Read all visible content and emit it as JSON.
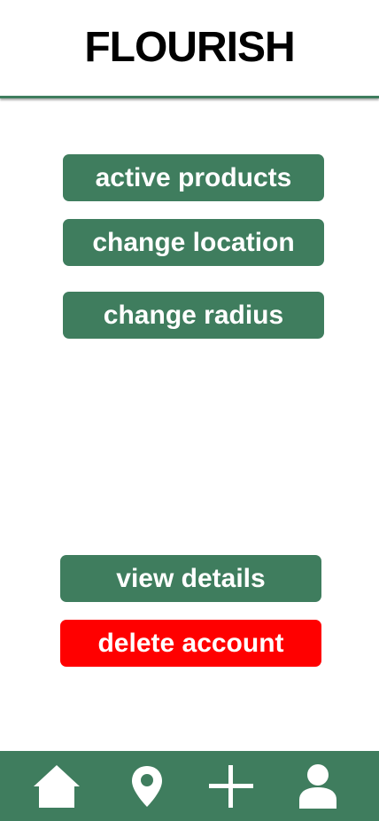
{
  "app": {
    "title": "FLOURISH"
  },
  "menu": {
    "active_products": "active products",
    "change_location": "change location",
    "change_radius": "change radius"
  },
  "account": {
    "view_details": "view details",
    "delete_account": "delete account"
  },
  "nav": {
    "items": [
      {
        "icon": "home-icon"
      },
      {
        "icon": "location-pin-icon"
      },
      {
        "icon": "plus-icon"
      },
      {
        "icon": "user-icon"
      }
    ]
  },
  "colors": {
    "accent": "#3f7d5e",
    "danger": "#ff0000",
    "background": "#ffffff",
    "title": "#000000"
  }
}
